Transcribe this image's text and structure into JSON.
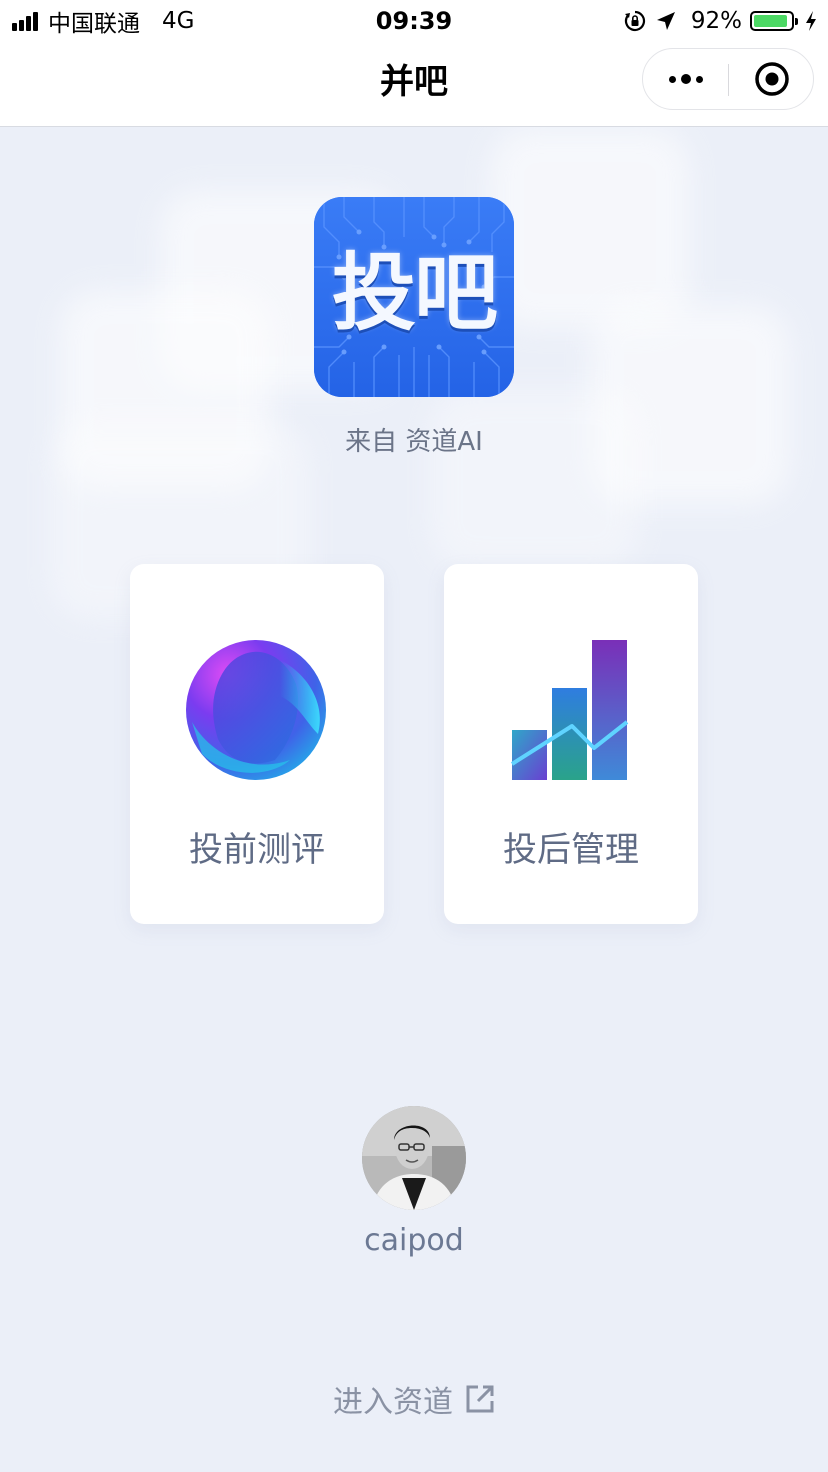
{
  "status_bar": {
    "carrier": "中国联通",
    "network": "4G",
    "time": "09:39",
    "battery_percent": "92%",
    "battery_level": 0.92,
    "icons": [
      "signal-icon",
      "rotation-lock-icon",
      "location-arrow-icon",
      "battery-icon",
      "charging-bolt-icon"
    ]
  },
  "nav": {
    "title": "并吧",
    "more_icon": "more-dots-icon",
    "close_icon": "target-close-icon"
  },
  "app": {
    "logo_text": "投吧",
    "from_label": "来自 资道AI"
  },
  "cards": [
    {
      "label": "投前测评",
      "icon": "gradient-sphere-icon"
    },
    {
      "label": "投后管理",
      "icon": "bar-chart-icon"
    }
  ],
  "user": {
    "name": "caipod"
  },
  "footer": {
    "enter_label": "进入资道",
    "link_icon": "external-link-icon"
  },
  "colors": {
    "background": "#ebeff8",
    "logo_blue": "#2f6ff0",
    "label_text": "#5f6b85",
    "muted_text": "#8a92a4"
  }
}
